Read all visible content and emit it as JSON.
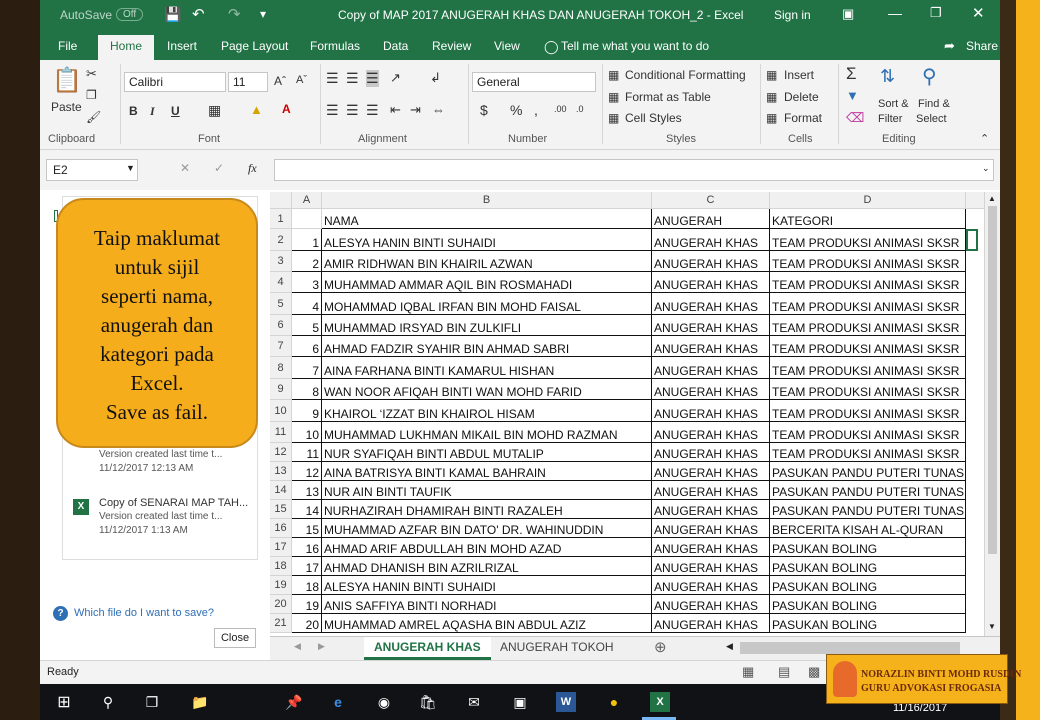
{
  "window": {
    "autosave_label": "AutoSave",
    "autosave_state": "Off",
    "title": "Copy of MAP 2017 ANUGERAH KHAS DAN ANUGERAH TOKOH_2  -  Excel",
    "signin": "Sign in"
  },
  "tabs": [
    "File",
    "Home",
    "Insert",
    "Page Layout",
    "Formulas",
    "Data",
    "Review",
    "View"
  ],
  "tell_me": "Tell me what you want to do",
  "share": "Share",
  "ribbon": {
    "paste": "Paste",
    "font_name": "Calibri",
    "font_size": "11",
    "number_format": "General",
    "conditional_formatting": "Conditional Formatting",
    "format_as_table": "Format as Table",
    "cell_styles": "Cell Styles",
    "insert": "Insert",
    "delete": "Delete",
    "format": "Format",
    "sort_filter_1": "Sort &",
    "sort_filter_2": "Filter",
    "find_select_1": "Find &",
    "find_select_2": "Select",
    "groups": [
      "Clipboard",
      "Font",
      "Alignment",
      "Number",
      "Styles",
      "Cells",
      "Editing"
    ]
  },
  "name_box": "E2",
  "fx": "fx",
  "pane": {
    "item1_line1": "Version created last time t...",
    "item1_line2": "11/12/2017 12:13 AM",
    "item2_title": "Copy of SENARAI MAP TAH...",
    "item2_line1": "Version created last time t...",
    "item2_line2": "11/12/2017 1:13 AM",
    "help_link": "Which file do I want to save?",
    "close": "Close"
  },
  "columns": [
    "A",
    "B",
    "C",
    "D"
  ],
  "header_row": [
    "NAMA",
    "ANUGERAH",
    "KATEGORI"
  ],
  "rows": [
    [
      "1",
      "ALESYA HANIN BINTI SUHAIDI",
      "ANUGERAH KHAS",
      "TEAM PRODUKSI ANIMASI SKSR"
    ],
    [
      "2",
      "AMIR RIDHWAN BIN KHAIRIL AZWAN",
      "ANUGERAH KHAS",
      "TEAM PRODUKSI ANIMASI SKSR"
    ],
    [
      "3",
      "MUHAMMAD AMMAR AQIL BIN ROSMAHADI",
      "ANUGERAH KHAS",
      "TEAM PRODUKSI ANIMASI SKSR"
    ],
    [
      "4",
      "MOHAMMAD IQBAL IRFAN BIN MOHD FAISAL",
      "ANUGERAH KHAS",
      "TEAM PRODUKSI ANIMASI SKSR"
    ],
    [
      "5",
      "MUHAMMAD IRSYAD BIN ZULKIFLI",
      "ANUGERAH KHAS",
      "TEAM PRODUKSI ANIMASI SKSR"
    ],
    [
      "6",
      "AHMAD FADZIR SYAHIR BIN AHMAD SABRI",
      "ANUGERAH KHAS",
      "TEAM PRODUKSI ANIMASI SKSR"
    ],
    [
      "7",
      "AINA FARHANA BINTI KAMARUL HISHAN",
      "ANUGERAH KHAS",
      "TEAM PRODUKSI ANIMASI SKSR"
    ],
    [
      "8",
      "WAN NOOR AFIQAH BINTI WAN MOHD FARID",
      "ANUGERAH KHAS",
      "TEAM PRODUKSI ANIMASI SKSR"
    ],
    [
      "9",
      "KHAIROL ‘IZZAT BIN KHAIROL HISAM",
      "ANUGERAH KHAS",
      "TEAM PRODUKSI ANIMASI SKSR"
    ],
    [
      "10",
      "MUHAMMAD LUKHMAN MIKAIL BIN MOHD RAZMAN",
      "ANUGERAH KHAS",
      "TEAM PRODUKSI ANIMASI SKSR"
    ],
    [
      "11",
      "NUR SYAFIQAH BINTI ABDUL MUTALIP",
      "ANUGERAH KHAS",
      "TEAM PRODUKSI ANIMASI SKSR"
    ],
    [
      "12",
      "AINA BATRISYA BINTI KAMAL BAHRAIN",
      "ANUGERAH KHAS",
      "PASUKAN PANDU PUTERI TUNAS"
    ],
    [
      "13",
      "NUR AIN BINTI TAUFIK",
      "ANUGERAH KHAS",
      "PASUKAN PANDU PUTERI TUNAS"
    ],
    [
      "14",
      "NURHAZIRAH DHAMIRAH BINTI RAZALEH",
      "ANUGERAH KHAS",
      "PASUKAN PANDU PUTERI TUNAS"
    ],
    [
      "15",
      "MUHAMMAD AZFAR BIN DATO' DR. WAHINUDDIN",
      "ANUGERAH KHAS",
      "BERCERITA KISAH AL-QURAN"
    ],
    [
      "16",
      "AHMAD ARIF ABDULLAH BIN MOHD AZAD",
      "ANUGERAH KHAS",
      "PASUKAN BOLING"
    ],
    [
      "17",
      "AHMAD DHANISH BIN AZRILRIZAL",
      "ANUGERAH KHAS",
      "PASUKAN BOLING"
    ],
    [
      "18",
      "ALESYA HANIN BINTI SUHAIDI",
      "ANUGERAH KHAS",
      "PASUKAN BOLING"
    ],
    [
      "19",
      "ANIS SAFFIYA BINTI NORHADI",
      "ANUGERAH KHAS",
      "PASUKAN BOLING"
    ],
    [
      "20",
      "MUHAMMAD AMREL AQASHA BIN ABDUL AZIZ",
      "ANUGERAH KHAS",
      "PASUKAN BOLING"
    ]
  ],
  "sheet_tabs": [
    "ANUGERAH KHAS",
    "ANUGERAH TOKOH"
  ],
  "status": "Ready",
  "callout": [
    "Taip maklumat",
    "untuk sijil",
    "seperti nama,",
    "anugerah dan",
    "kategori pada",
    "Excel.",
    "Save as fail."
  ],
  "badge": {
    "line1": "NORAZLIN BINTI MOHD RUSDIN",
    "line2": "GURU ADVOKASI FROGASIA"
  },
  "clock_date": "11/16/2017"
}
